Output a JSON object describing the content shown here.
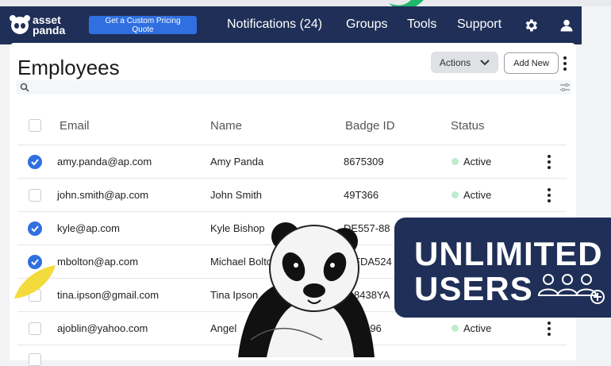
{
  "navbar": {
    "logo_line1": "asset",
    "logo_line2": "panda",
    "quote_button": "Get a Custom Pricing Quote",
    "links": [
      "Notifications (24)",
      "Groups",
      "Tools",
      "Support"
    ],
    "icons": [
      "gear-icon",
      "user-icon"
    ]
  },
  "page": {
    "title": "Employees",
    "actions_label": "Actions",
    "add_new_label": "Add New",
    "search_placeholder": ""
  },
  "table": {
    "headers": [
      "Email",
      "Name",
      "Badge ID",
      "Status"
    ],
    "rows": [
      {
        "checked": true,
        "email": "amy.panda@ap.com",
        "name": "Amy Panda",
        "badge": "8675309",
        "status": "Active"
      },
      {
        "checked": false,
        "email": "john.smith@ap.com",
        "name": "John Smith",
        "badge": "49T366",
        "status": "Active"
      },
      {
        "checked": true,
        "email": "kyle@ap.com",
        "name": "Kyle Bishop",
        "badge": "DE557-88",
        "status": ""
      },
      {
        "checked": true,
        "email": "mbolton@ap.com",
        "name": "Michael Bolto",
        "badge": "FDA524",
        "status": ""
      },
      {
        "checked": false,
        "email": "tina.ipson@gmail.com",
        "name": "Tina Ipson",
        "badge": "8438YA",
        "status": ""
      },
      {
        "checked": false,
        "email": "ajoblin@yahoo.com",
        "name": "Angel",
        "badge": "-96",
        "status": "Active"
      }
    ]
  },
  "banner": {
    "line1": "UNLIMITED",
    "line2": "USERS"
  },
  "colors": {
    "nav_bg": "#1f2f57",
    "accent": "#2f6fe0",
    "status_active": "#bfeccf"
  }
}
